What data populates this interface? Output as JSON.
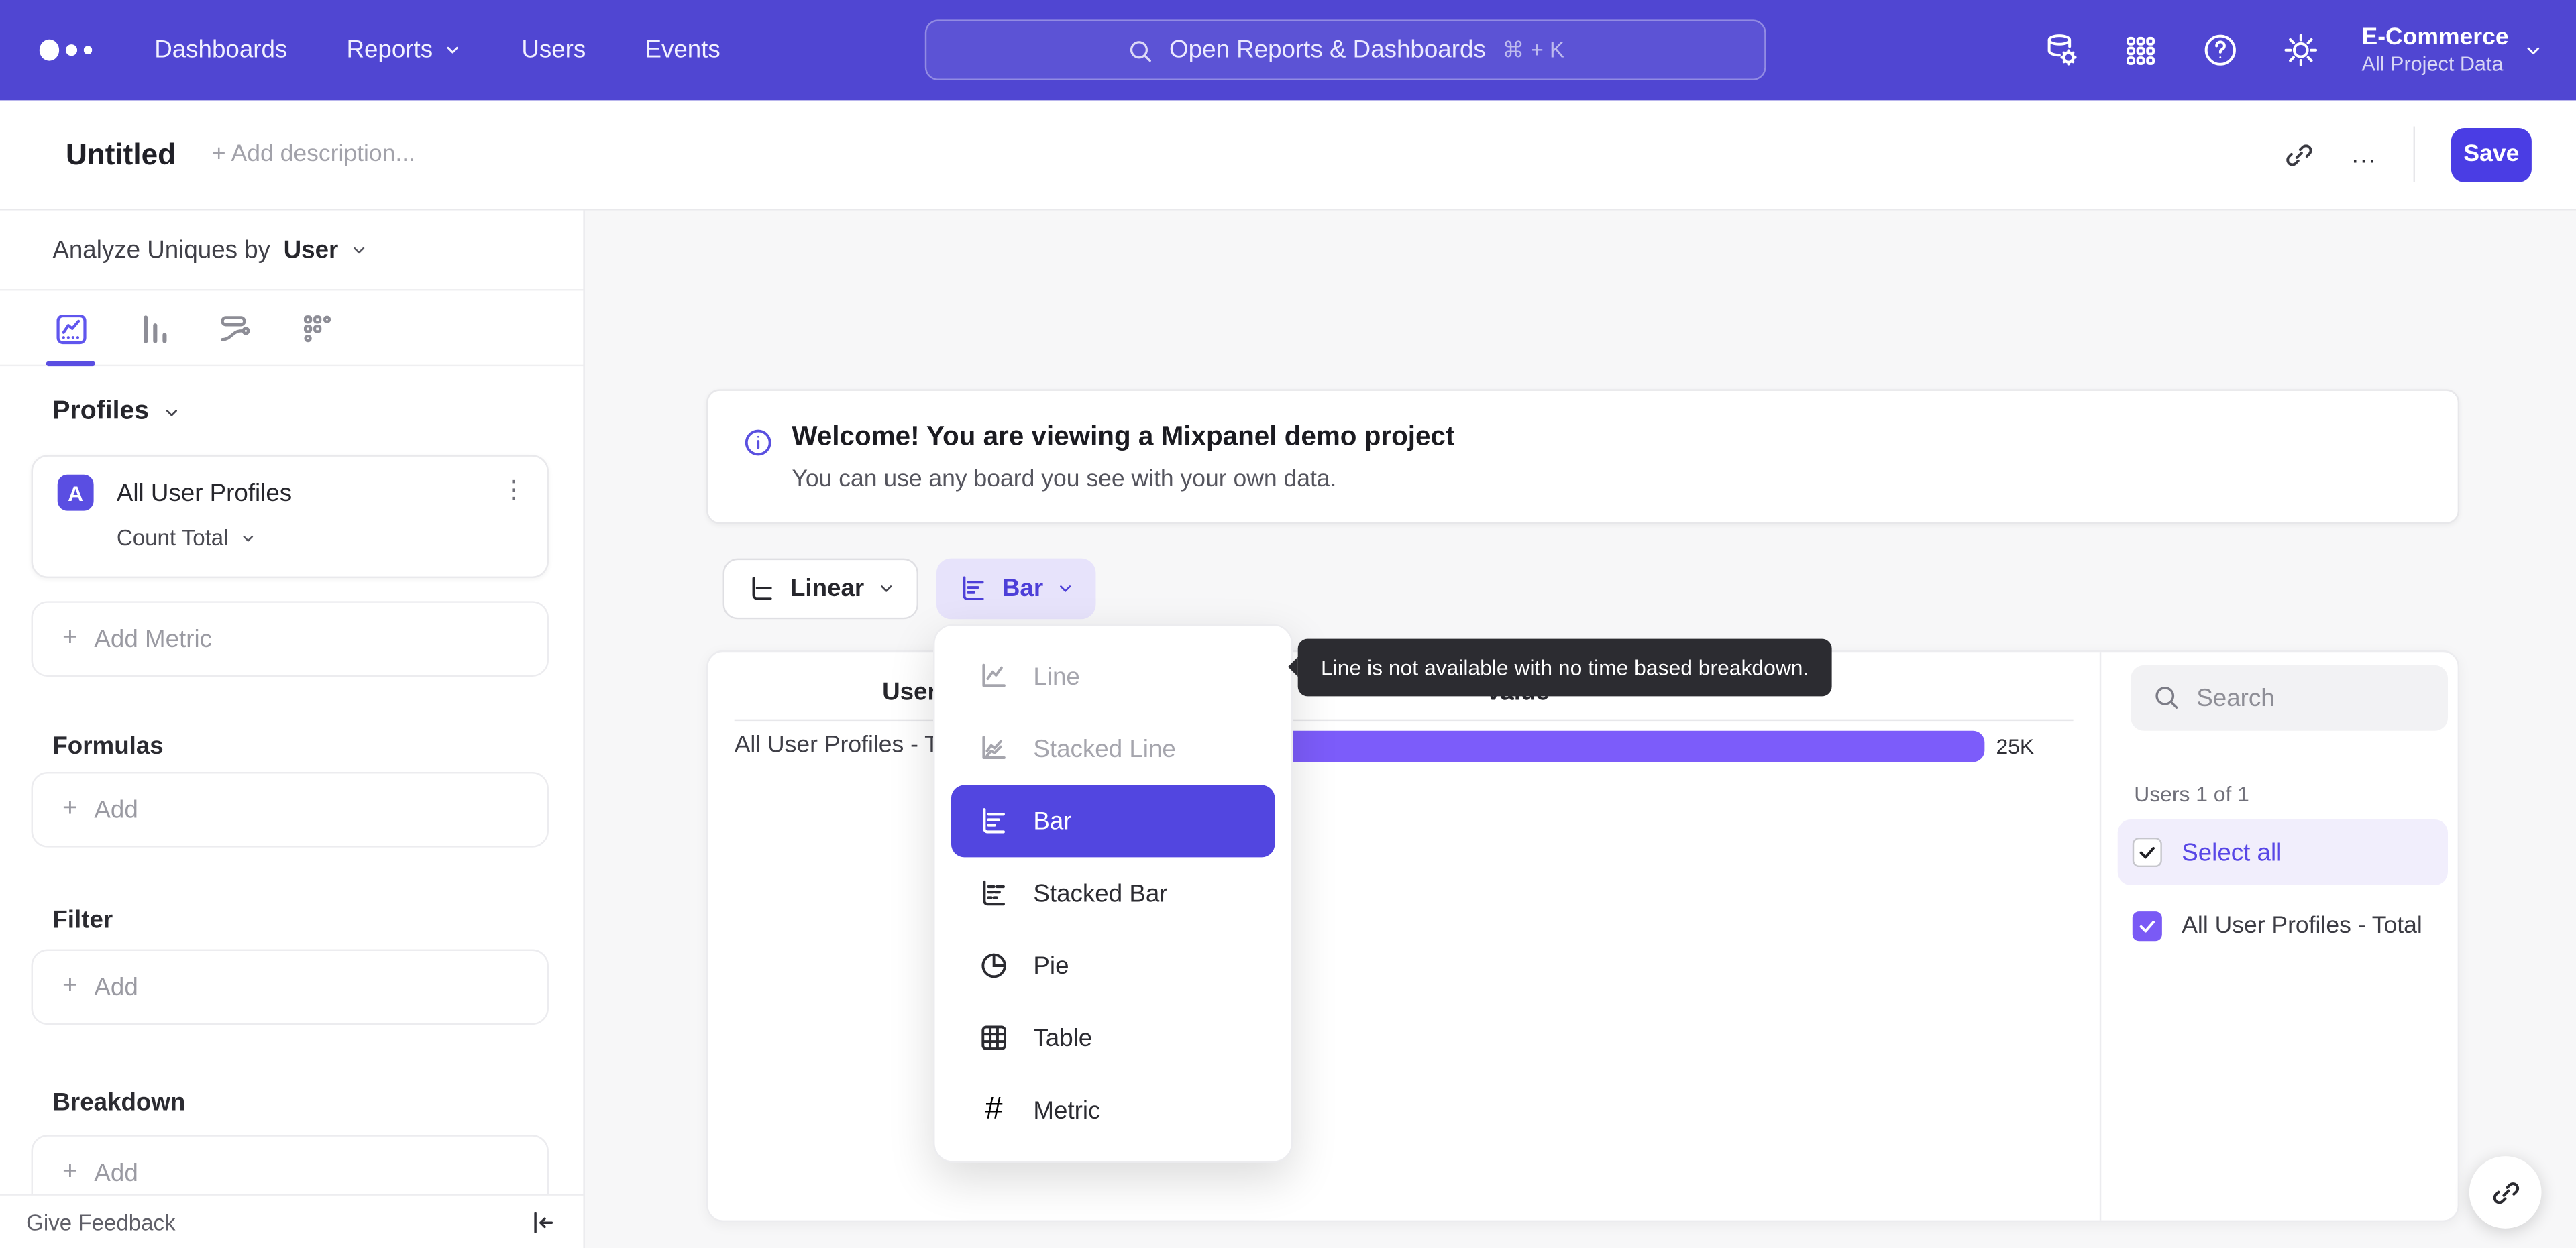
{
  "colors": {
    "nav_bg": "#5046d2",
    "accent": "#5246e0",
    "bar_fill": "#7c5cfa",
    "save_bg": "#4a3de4",
    "select_all_text": "#5847e6"
  },
  "topnav": {
    "items": [
      "Dashboards",
      "Reports",
      "Users",
      "Events"
    ],
    "search_placeholder": "Open Reports & Dashboards",
    "search_shortcut": "⌘ + K",
    "project_name": "E-Commerce",
    "project_scope": "All Project Data"
  },
  "toolbar": {
    "title": "Untitled",
    "description_placeholder": "+ Add description...",
    "more": "...",
    "save": "Save"
  },
  "sidebar": {
    "analyze_prefix": "Analyze Uniques by",
    "analyze_value": "User",
    "profiles_header": "Profiles",
    "metric": {
      "badge": "A",
      "name": "All User Profiles",
      "aggregation": "Count Total",
      "menu": "⋮"
    },
    "plus": "+",
    "add_metric": "Add Metric",
    "sections": [
      {
        "title": "Formulas",
        "add": "Add"
      },
      {
        "title": "Filter",
        "add": "Add"
      },
      {
        "title": "Breakdown",
        "add": "Add"
      }
    ],
    "feedback": "Give Feedback"
  },
  "banner": {
    "title": "Welcome! You are viewing a Mixpanel demo project",
    "subtitle": "You can use any board you see with your own data."
  },
  "controls": {
    "scale_label": "Linear",
    "type_label": "Bar"
  },
  "type_menu": {
    "hash_glyph": "#",
    "items": [
      {
        "label": "Line",
        "state": "disabled"
      },
      {
        "label": "Stacked Line",
        "state": "disabled"
      },
      {
        "label": "Bar",
        "state": "selected"
      },
      {
        "label": "Stacked Bar",
        "state": "normal"
      },
      {
        "label": "Pie",
        "state": "normal"
      },
      {
        "label": "Table",
        "state": "normal"
      },
      {
        "label": "Metric",
        "state": "normal"
      }
    ]
  },
  "tooltip": {
    "text": "Line is not available with no time based breakdown."
  },
  "chart_data": {
    "type": "bar",
    "orientation": "horizontal",
    "columns": [
      "Users",
      "Value"
    ],
    "categories": [
      "All User Profiles - Total"
    ],
    "series": [
      {
        "name": "All User Profiles - Total",
        "values": [
          25000
        ]
      }
    ],
    "value_labels": [
      "25K"
    ],
    "bar_color": "#7c5cfa",
    "xlim": [
      0,
      25000
    ],
    "grid": false,
    "legend_position": "right"
  },
  "legend": {
    "search_placeholder": "Search",
    "count_label": "Users 1 of 1",
    "select_all": "Select all",
    "items": [
      {
        "label": "All User Profiles - Total",
        "checked": true
      }
    ]
  }
}
